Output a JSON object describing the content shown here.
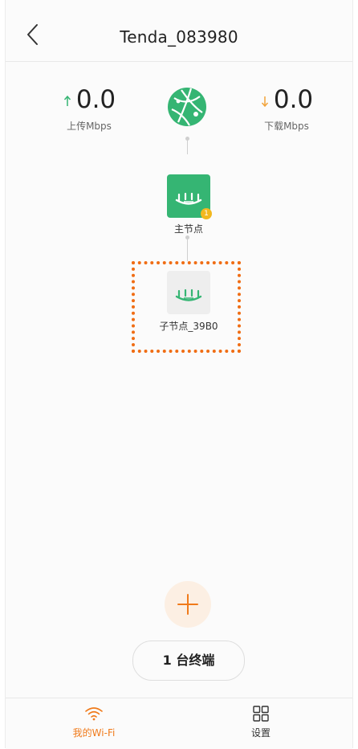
{
  "header": {
    "title": "Tenda_083980",
    "back_icon": "chevron-left-icon"
  },
  "upload": {
    "value": "0.0",
    "unit": "上传Mbps",
    "color": "#35b573"
  },
  "download": {
    "value": "0.0",
    "unit": "下载Mbps",
    "color": "#f2a33a"
  },
  "topology": {
    "internet_icon": "globe-icon",
    "main_node": {
      "label": "主节点",
      "badge": "1",
      "icon": "router-icon"
    },
    "sub_node": {
      "label": "子节点_39B0",
      "icon": "router-icon"
    }
  },
  "actions": {
    "add_icon": "plus-icon",
    "terminals_label": "1 台终端"
  },
  "nav": {
    "wifi_label": "我的Wi-Fi",
    "settings_label": "设置"
  },
  "colors": {
    "accent": "#f07a1a",
    "green": "#35b573",
    "highlight": "#f06d14"
  }
}
